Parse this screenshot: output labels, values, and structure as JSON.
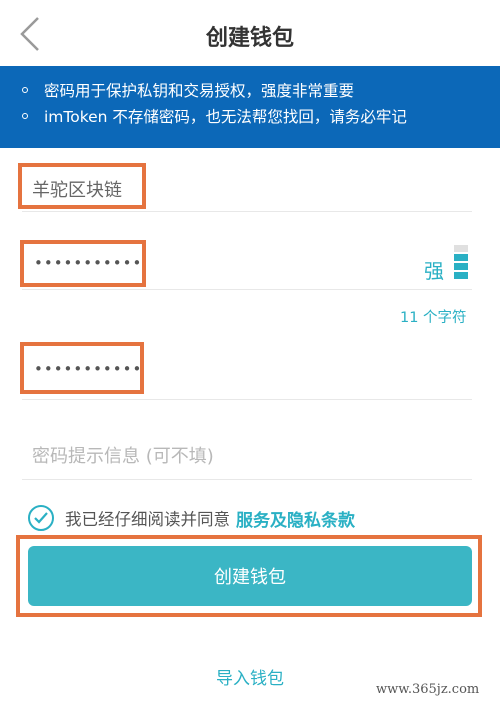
{
  "header": {
    "title": "创建钱包"
  },
  "notice": {
    "items": [
      "密码用于保护私钥和交易授权，强度非常重要",
      "imToken 不存储密码，也无法帮您找回，请务必牢记"
    ]
  },
  "form": {
    "wallet_name": "羊驼区块链",
    "password_masked": "•••••••••••",
    "strength_label": "强",
    "strength_level": "3/4",
    "char_count": "11 个字符",
    "confirm_password_masked": "•••••••••••",
    "hint_placeholder": "密码提示信息 (可不填)"
  },
  "agreement": {
    "text": "我已经仔细阅读并同意",
    "link_text": "服务及隐私条款",
    "checked": true
  },
  "actions": {
    "create_label": "创建钱包",
    "import_label": "导入钱包"
  },
  "watermark": "www.365jz.com",
  "colors": {
    "notice_bg": "#0c68b8",
    "accent": "#2ab0c4",
    "button": "#3bb6c5",
    "highlight": "#e5733f"
  }
}
